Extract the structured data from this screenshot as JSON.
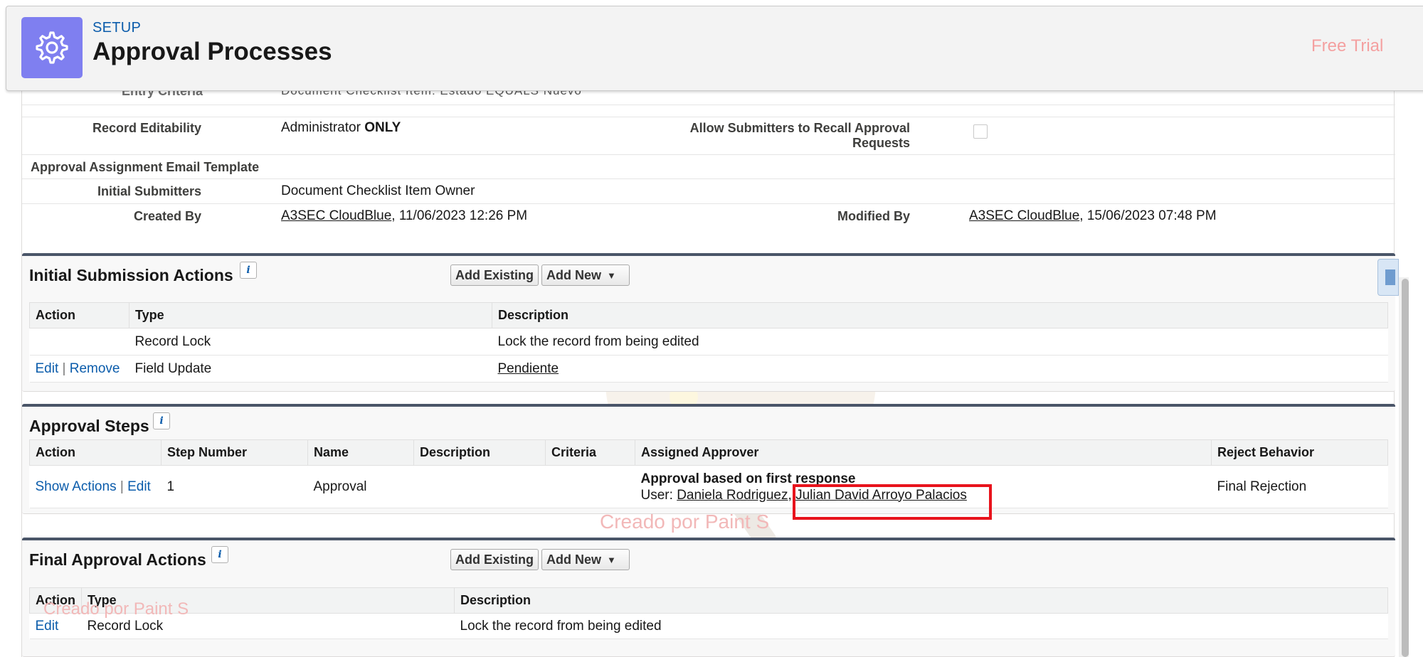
{
  "header": {
    "eyebrow": "SETUP",
    "title": "Approval Processes",
    "trial": "Free Trial",
    "icon": "gear-icon",
    "icon_bg": "#7f7ff0"
  },
  "details": {
    "cut_label": "Entry Criteria",
    "cut_value": "Document Checklist Item: Estado EQUALS Nuevo",
    "record_editability_label": "Record Editability",
    "record_editability_value_prefix": "Administrator",
    "record_editability_value_bold": "ONLY",
    "allow_recall_label": "Allow Submitters to Recall Approval Requests",
    "email_template_label": "Approval Assignment Email Template",
    "email_template_value": "",
    "initial_submitters_label": "Initial Submitters",
    "initial_submitters_value": "Document Checklist Item Owner",
    "created_by_label": "Created By",
    "created_by_user": "A3SEC CloudBlue",
    "created_by_date": ", 11/06/2023 12:26 PM",
    "modified_by_label": "Modified By",
    "modified_by_user": "A3SEC CloudBlue",
    "modified_by_date": ", 15/06/2023 07:48 PM"
  },
  "initial_submission": {
    "title": "Initial Submission Actions",
    "add_existing": "Add Existing",
    "add_new": "Add New",
    "columns": [
      "Action",
      "Type",
      "Description"
    ],
    "rows": [
      {
        "edit": "",
        "remove": "",
        "type": "Record Lock",
        "description": "Lock the record from being edited"
      },
      {
        "edit": "Edit",
        "remove": "Remove",
        "type": "Field Update",
        "description": "Pendiente"
      }
    ]
  },
  "approval_steps": {
    "title": "Approval Steps",
    "columns": [
      "Action",
      "Step Number",
      "Name",
      "Description",
      "Criteria",
      "Assigned Approver",
      "Reject Behavior"
    ],
    "row": {
      "show_actions": "Show Actions",
      "edit": "Edit",
      "step_number": "1",
      "name": "Approval",
      "description": "",
      "criteria": "",
      "approver_heading": "Approval based on first response",
      "approver_prefix": "User: ",
      "approver_1": "Daniela Rodriguez",
      "approver_sep": ", ",
      "approver_2": "Julian David Arroyo Palacios",
      "reject_behavior": "Final Rejection"
    }
  },
  "final_approval": {
    "title": "Final Approval Actions",
    "add_existing": "Add Existing",
    "add_new": "Add New",
    "columns": [
      "Action",
      "Type",
      "Description"
    ],
    "rows": [
      {
        "edit": "Edit",
        "type": "Record Lock",
        "description": "Lock the record from being edited"
      }
    ]
  },
  "watermarks": {
    "center": "Creado por Paint S",
    "bottom": "Creado por Paint S"
  },
  "colors": {
    "link": "#0b5cab",
    "highlight": "#e8131c",
    "section_border": "#4a5568"
  }
}
